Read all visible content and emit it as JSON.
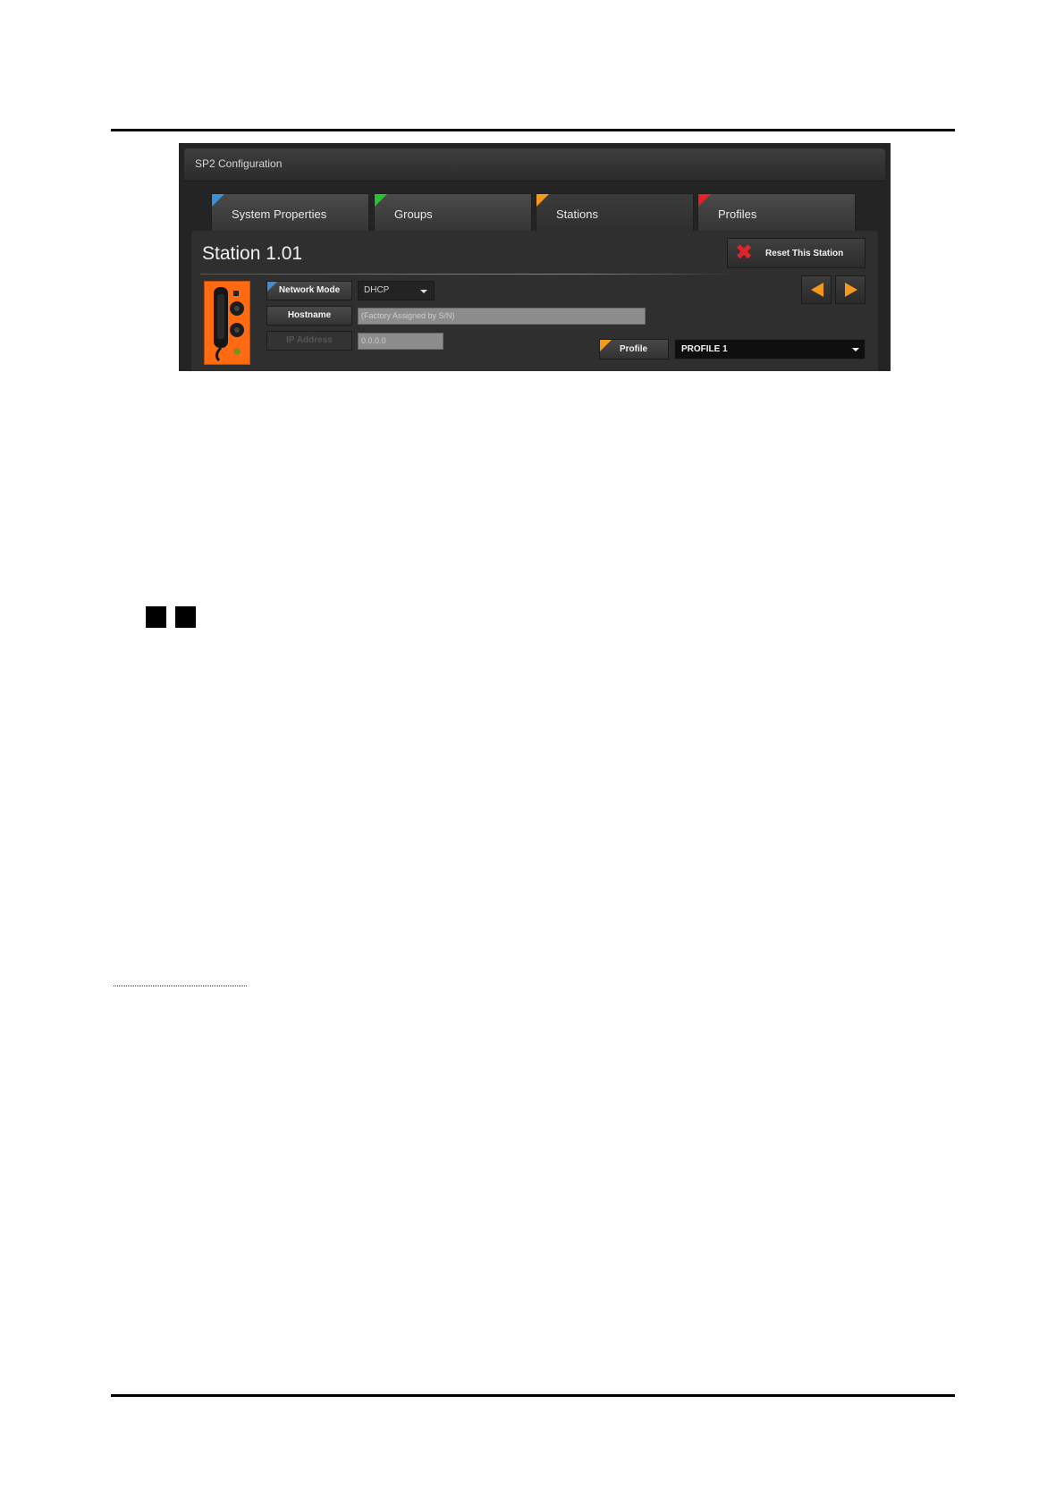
{
  "window": {
    "title": "SP2 Configuration"
  },
  "tabs": [
    {
      "label": "System Properties",
      "color": "#3a8fd8"
    },
    {
      "label": "Groups",
      "color": "#2bbf3a"
    },
    {
      "label": "Stations",
      "color": "#f39a1c",
      "active": true
    },
    {
      "label": "Profiles",
      "color": "#e0242a"
    }
  ],
  "station": {
    "title": "Station 1.01",
    "reset_label": "Reset This Station",
    "fields": {
      "network_mode_label": "Network Mode",
      "network_mode_value": "DHCP",
      "hostname_label": "Hostname",
      "hostname_placeholder": "(Factory Assigned by S/N)",
      "ip_label": "IP Address",
      "ip_value": "0.0.0.0"
    },
    "profile_label": "Profile",
    "profile_value": "PROFILE 1"
  },
  "colors": {
    "accent": "#f39a1c",
    "station_image": "#ff6a13"
  }
}
